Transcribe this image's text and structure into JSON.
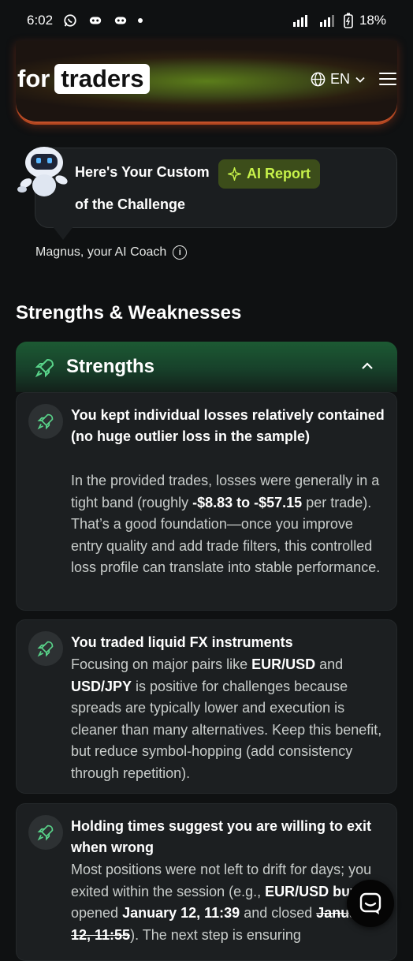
{
  "status_bar": {
    "time": "6:02",
    "battery": "18%"
  },
  "header": {
    "logo_prefix": "for",
    "logo_boxed": "traders",
    "language": "EN"
  },
  "coach": {
    "line1": "Here's Your Custom",
    "badge": "AI Report",
    "line2": "of the Challenge",
    "name": "Magnus, your AI Coach"
  },
  "section_title": "Strengths & Weaknesses",
  "strengths": {
    "label": "Strengths",
    "items": [
      {
        "title": "You kept individual losses relatively contained (no huge outlier loss in the sample)",
        "body_a": "In the provided trades, losses were generally in a tight band (roughly ",
        "body_b": "-$8.83 to -$57.15",
        "body_c": " per trade). That’s a good foundation—once you improve entry quality and add trade filters, this controlled loss profile can translate into stable performance."
      },
      {
        "title": "You traded liquid FX instruments",
        "body_a": "Focusing on major pairs like ",
        "body_b": "EUR/USD",
        "body_c": " and ",
        "body_d": "USD/JPY",
        "body_e": " is positive for challenges because spreads are typically lower and execution is cleaner than many alternatives. Keep this benefit, but reduce symbol-hopping (add consistency through repetition)."
      },
      {
        "title": "Holding times suggest you are willing to exit when wrong",
        "body_a": "Most positions were not left to drift for days; you exited within the session (e.g., ",
        "body_b": "EUR/USD buy",
        "body_c": " opened ",
        "body_d": "January 12, 11:39",
        "body_e": " and closed ",
        "body_f": "January 12, 11:55",
        "body_g": "). The next step is ensuring"
      }
    ]
  }
}
